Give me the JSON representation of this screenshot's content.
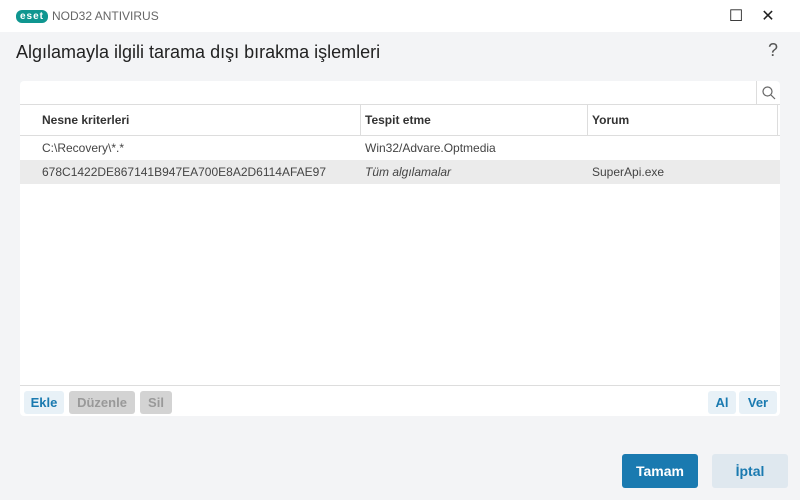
{
  "titlebar": {
    "logo": "eset",
    "app_name": "NOD32 ANTIVIRUS",
    "minimize": "☐",
    "close": "✕"
  },
  "page": {
    "title": "Algılamayla ilgili tarama dışı bırakma işlemleri",
    "help": "?"
  },
  "table": {
    "columns": [
      "Nesne kriterleri",
      "Tespit etme",
      "Yorum"
    ],
    "rows": [
      {
        "object": "C:\\Recovery\\*.*",
        "detection": "Win32/Advare.Optmedia",
        "comment": ""
      },
      {
        "object": "678C1422DE867141B947EA700E8A2D6114AFAE97",
        "detection": "Tüm algılamalar",
        "comment": "SuperApi.exe"
      }
    ]
  },
  "footer": {
    "add": "Ekle",
    "edit": "Düzenle",
    "delete": "Sil",
    "import": "Al",
    "export": "Ver"
  },
  "dialog": {
    "ok": "Tamam",
    "cancel": "İptal"
  },
  "colors": {
    "accent": "#1a7ab0",
    "brand": "#0f9690"
  }
}
